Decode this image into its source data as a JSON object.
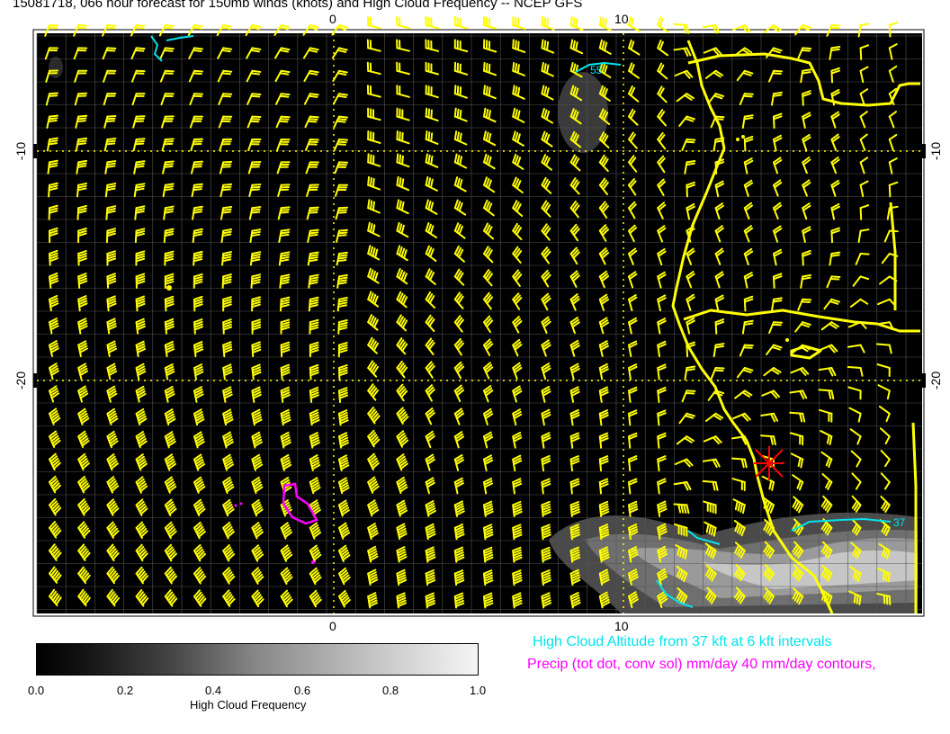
{
  "title": "15081718, 066 hour forecast for 150mb winds (knots) and High Cloud Frequency -- NCEP GFS",
  "axes": {
    "lon_ticks_top": [
      "0",
      "10"
    ],
    "lon_ticks_bottom": [
      "0",
      "10"
    ],
    "lat_ticks_left": [
      "-10",
      "-20"
    ],
    "lat_ticks_right": [
      "-10",
      "-20"
    ]
  },
  "contour_labels": {
    "cloud_altitude_a": "55",
    "cloud_altitude_b": "37"
  },
  "colorbar": {
    "title": "High Cloud Frequency",
    "ticks": [
      "0.0",
      "0.2",
      "0.4",
      "0.6",
      "0.8",
      "1.0"
    ]
  },
  "legend": {
    "cloud_altitude": "High Cloud Altitude from 37 kft at 6 kft intervals",
    "precip": "Precip (tot dot, conv sol) mm/day 40 mm/day contours,"
  },
  "colors": {
    "wind_barbs": "#ffff00",
    "coastline": "#ffff00",
    "cloud_altitude_contour": "#00e5ee",
    "precip_contour": "#ff00ff",
    "station_marker": "#ff0000"
  }
}
